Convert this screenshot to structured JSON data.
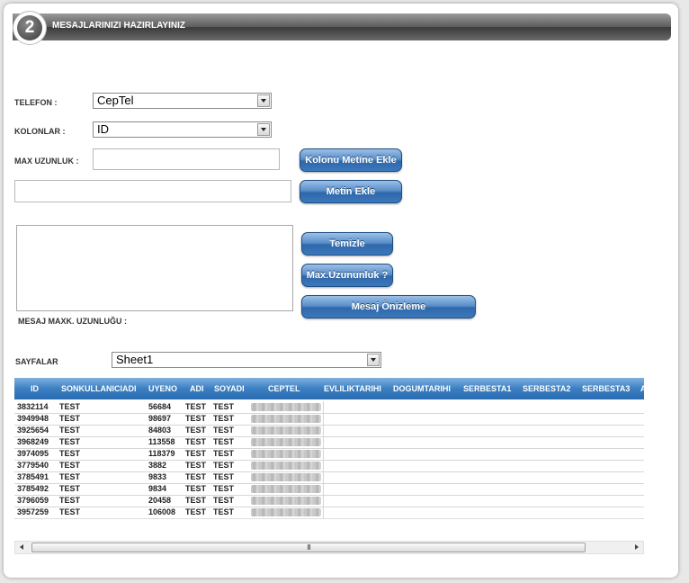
{
  "header": {
    "step": "2",
    "title": "MESAJLARINIZI HAZIRLAYINIZ"
  },
  "form": {
    "telefon_label": "TELEFON :",
    "telefon_value": "CepTel",
    "kolonlar_label": "KOLONLAR :",
    "kolonlar_value": "ID",
    "max_label": "MAX UZUNLUK :",
    "max_value": "",
    "metin_value": "",
    "mesaj_value": "",
    "mesaj_max_label": "MESAJ MAXK. UZUNLUĞU :",
    "sayfalar_label": "SAYFALAR",
    "sayfalar_value": "Sheet1"
  },
  "buttons": {
    "kolonu_metine_ekle": "Kolonu Metine Ekle",
    "metin_ekle": "Metin Ekle",
    "temizle": "Temizle",
    "max_uzunluk": "Max.Uzununluk ?",
    "mesaj_onizleme": "Mesaj Önizleme"
  },
  "grid": {
    "columns": [
      "ID",
      "SONKULLANICIADI",
      "UYENO",
      "ADI",
      "SOYADI",
      "CEPTEL",
      "EVLILIKTARIHI",
      "DOGUMTARIHI",
      "SERBESTA1",
      "SERBESTA2",
      "SERBESTA3",
      "A"
    ],
    "rows": [
      {
        "id": "3832114",
        "user": "TEST",
        "uyeno": "56684",
        "adi": "TEST",
        "soyadi": "TEST"
      },
      {
        "id": "3949948",
        "user": "TEST",
        "uyeno": "98697",
        "adi": "TEST",
        "soyadi": "TEST"
      },
      {
        "id": "3925654",
        "user": "TEST",
        "uyeno": "84803",
        "adi": "TEST",
        "soyadi": "TEST"
      },
      {
        "id": "3968249",
        "user": "TEST",
        "uyeno": "113558",
        "adi": "TEST",
        "soyadi": "TEST"
      },
      {
        "id": "3974095",
        "user": "TEST",
        "uyeno": "118379",
        "adi": "TEST",
        "soyadi": "TEST"
      },
      {
        "id": "3779540",
        "user": "TEST",
        "uyeno": "3882",
        "adi": "TEST",
        "soyadi": "TEST"
      },
      {
        "id": "3785491",
        "user": "TEST",
        "uyeno": "9833",
        "adi": "TEST",
        "soyadi": "TEST"
      },
      {
        "id": "3785492",
        "user": "TEST",
        "uyeno": "9834",
        "adi": "TEST",
        "soyadi": "TEST"
      },
      {
        "id": "3796059",
        "user": "TEST",
        "uyeno": "20458",
        "adi": "TEST",
        "soyadi": "TEST"
      },
      {
        "id": "3957259",
        "user": "TEST",
        "uyeno": "106008",
        "adi": "TEST",
        "soyadi": "TEST"
      }
    ]
  },
  "scrollbar": {
    "thumb_grip": "III"
  },
  "colors": {
    "accent": "#3c7fc2",
    "header_bar": "#5c5c5c"
  }
}
